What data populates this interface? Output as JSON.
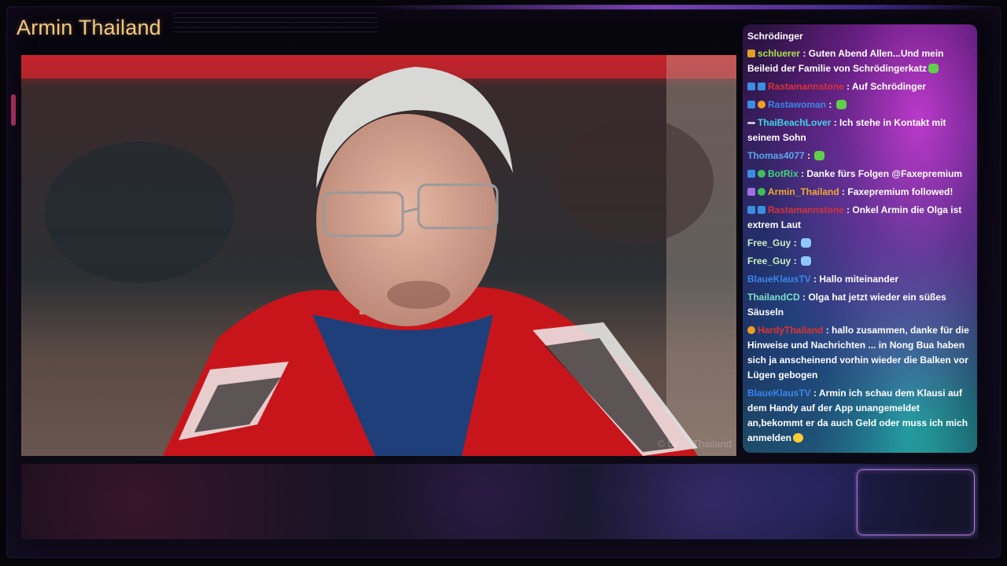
{
  "stream": {
    "channel_title": "Armin Thailand",
    "video_watermark": "© by ... Thailand"
  },
  "chat": {
    "header": "Schrödinger",
    "messages": [
      {
        "user": "schluerer",
        "user_color": "#a6e34a",
        "badges": [
          "gold"
        ],
        "text": "Guten Abend Allen...Und mein Beileid der Familie von Schrödingerkatz",
        "emote": "green"
      },
      {
        "user": "Rastamannstone",
        "user_color": "#d8323a",
        "badges": [
          "blue",
          "blue"
        ],
        "text": "Auf Schrödinger",
        "emote": ""
      },
      {
        "user": "Rastawoman",
        "user_color": "#3a86e8",
        "badges": [
          "blue",
          "orange"
        ],
        "text": "",
        "emote": "green"
      },
      {
        "user": "ThaiBeachLover",
        "user_color": "#3fd6e8",
        "badges": [
          "gray"
        ],
        "text": "Ich stehe in Kontakt mit seinem Sohn",
        "emote": ""
      },
      {
        "user": "Thomas4077",
        "user_color": "#5aa8f0",
        "badges": [],
        "text": "",
        "emote": "green"
      },
      {
        "user": "BotRix",
        "user_color": "#3fd67a",
        "badges": [
          "blue",
          "green"
        ],
        "text": "Danke fürs Folgen @Faxepremium",
        "emote": ""
      },
      {
        "user": "Armin_Thailand",
        "user_color": "#f0a832",
        "badges": [
          "purple",
          "green"
        ],
        "text": "Faxepremium followed!",
        "emote": ""
      },
      {
        "user": "Rastamannstone",
        "user_color": "#d8323a",
        "badges": [
          "blue",
          "blue"
        ],
        "text": "Onkel Armin die Olga ist extrem Laut",
        "emote": ""
      },
      {
        "user": "Free_Guy",
        "user_color": "#c9f0c0",
        "badges": [],
        "text": "",
        "emote": "blue"
      },
      {
        "user": "Free_Guy",
        "user_color": "#c9f0c0",
        "badges": [],
        "text": "",
        "emote": "blue"
      },
      {
        "user": "BlaueKlausTV",
        "user_color": "#3a86e8",
        "badges": [],
        "text": "Hallo miteinander",
        "emote": ""
      },
      {
        "user": "ThailandCD",
        "user_color": "#7ee0c8",
        "badges": [],
        "text": "Olga hat jetzt wieder ein süßes Säuseln",
        "emote": ""
      },
      {
        "user": "HardyThailand",
        "user_color": "#e0322a",
        "badges": [
          "orange"
        ],
        "text": "hallo zusammen, danke für die Hinweise und Nachrichten ... in Nong Bua haben sich ja anscheinend vorhin wieder die Balken vor Lügen gebogen",
        "emote": ""
      },
      {
        "user": "BlaueKlausTV",
        "user_color": "#3a86e8",
        "badges": [],
        "text": "Armin ich schau dem Klausi auf dem Handy auf der App unangemeldet an,bekommt er da auch Geld oder muss ich mich anmelden",
        "emote": "face"
      }
    ],
    "separator": " : "
  },
  "colors": {
    "title": "#f4c87e",
    "cam_border": "#b07ad8",
    "chat_text": "#ffffff"
  }
}
